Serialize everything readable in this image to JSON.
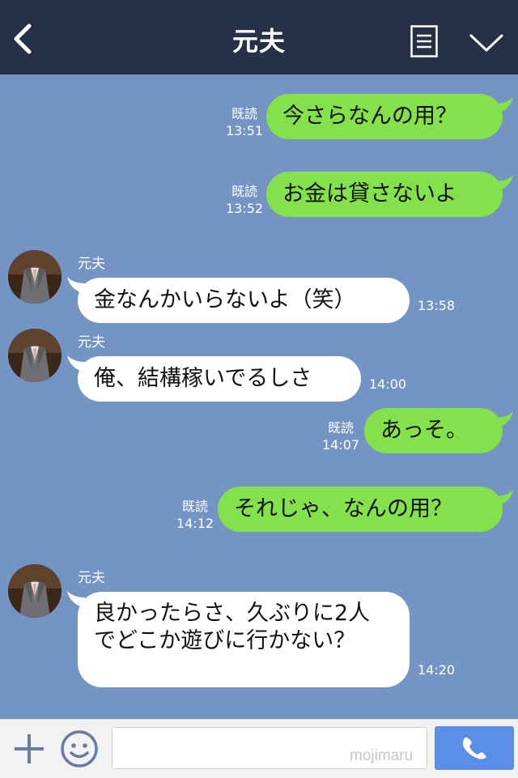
{
  "header": {
    "title": "元夫"
  },
  "messages": [
    {
      "side": "right",
      "read_label": "既読",
      "time": "13:51",
      "text": "今さらなんの用？"
    },
    {
      "side": "right",
      "read_label": "既読",
      "time": "13:52",
      "text": "お金は貸さないよ"
    },
    {
      "side": "left",
      "sender": "元夫",
      "time": "13:58",
      "text": "金なんかいらないよ（笑）"
    },
    {
      "side": "left",
      "sender": "元夫",
      "time": "14:00",
      "text": "俺、結構稼いでるしさ"
    },
    {
      "side": "right",
      "read_label": "既読",
      "time": "14:07",
      "text": "あっそ。"
    },
    {
      "side": "right",
      "read_label": "既読",
      "time": "14:12",
      "text": "それじゃ、なんの用？"
    },
    {
      "side": "left",
      "sender": "元夫",
      "time": "14:20",
      "text": "良かったらさ、久ぶりに2人でどこか遊びに行かない？"
    }
  ],
  "input": {
    "placeholder": ""
  },
  "watermark": "mojimaru",
  "colors": {
    "header_bg": "#263147",
    "chat_bg": "#7494c3",
    "sent_bubble": "#85e14b",
    "received_bubble": "#ffffff",
    "call_button": "#5b8ee6"
  },
  "icons": {
    "back": "chevron-left-icon",
    "menu": "menu-list-icon",
    "collapse": "chevron-down-icon",
    "add": "plus-icon",
    "emoji": "emoji-icon",
    "call": "phone-icon"
  }
}
